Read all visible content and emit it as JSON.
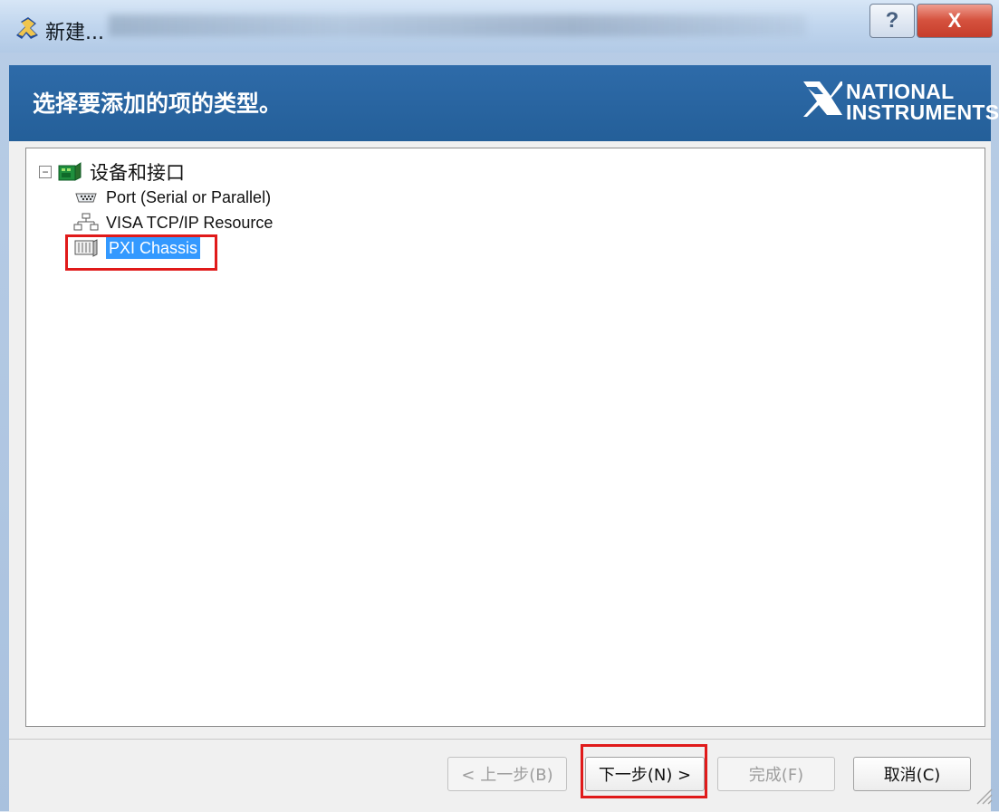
{
  "window": {
    "title": "新建...",
    "help_label": "?",
    "close_label": "X"
  },
  "header": {
    "title": "选择要添加的项的类型。",
    "brand_top": "NATIONAL",
    "brand_bottom": "INSTRUMENTS"
  },
  "tree": {
    "expander": "−",
    "root_label": "设备和接口",
    "items": [
      {
        "label": "Port (Serial or Parallel)",
        "icon": "serial-port-icon"
      },
      {
        "label": "VISA TCP/IP Resource",
        "icon": "network-icon"
      },
      {
        "label": "PXI Chassis",
        "icon": "chassis-icon",
        "selected": true
      }
    ]
  },
  "buttons": {
    "back": "< 上一步(B)",
    "next": "下一步(N) >",
    "finish": "完成(F)",
    "cancel": "取消(C)"
  },
  "colors": {
    "header_blue": "#2E6BA9",
    "selection_blue": "#3399FF",
    "annotation_red": "#E01A1A"
  }
}
